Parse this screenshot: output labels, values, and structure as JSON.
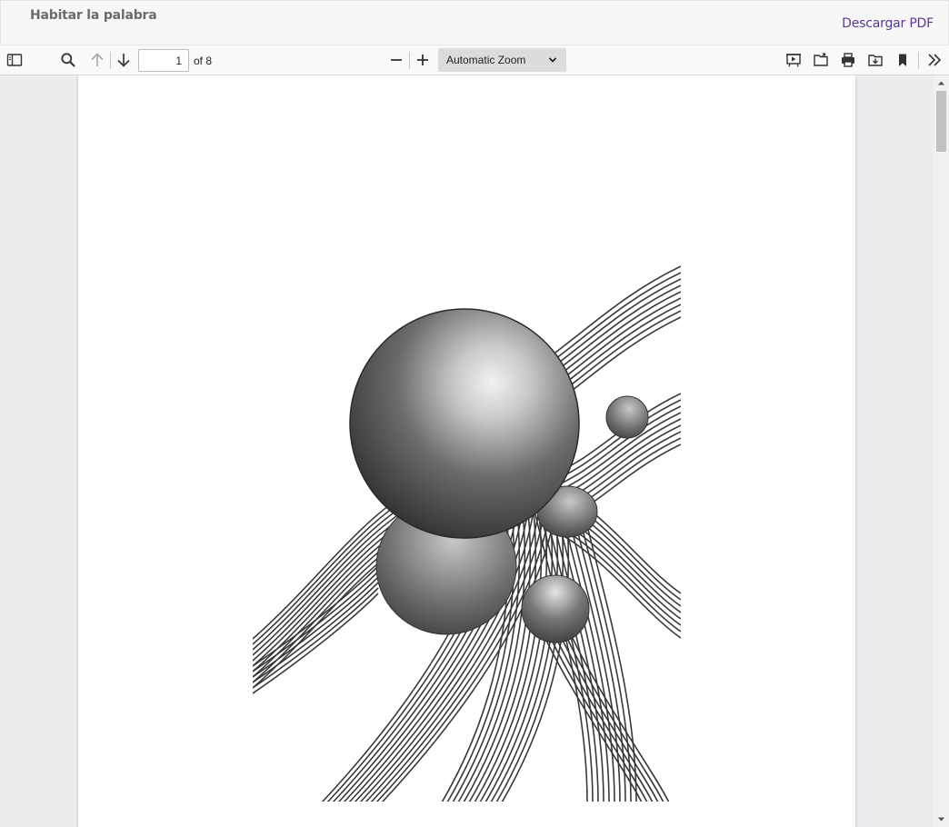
{
  "header": {
    "title": "Habitar la palabra",
    "download_label": "Descargar PDF",
    "accent_color": "#5b3a8c"
  },
  "toolbar": {
    "sidebar_toggle_icon": "sidebar-toggle-icon",
    "find_icon": "search-icon",
    "previous_icon": "arrow-up-icon",
    "next_icon": "arrow-down-icon",
    "page_number": "1",
    "page_count_label": "of 8",
    "zoom_out_icon": "minus-icon",
    "zoom_in_icon": "plus-icon",
    "zoom_value": "Automatic Zoom",
    "presentation_icon": "presentation-mode-icon",
    "open_file_icon": "open-file-icon",
    "print_icon": "print-icon",
    "download_icon": "download-icon",
    "bookmark_icon": "bookmark-icon",
    "tools_icon": "double-chevron-right-icon"
  },
  "document": {
    "current_page": 1,
    "total_pages": 8
  },
  "scrollbar": {
    "position_fraction": 0.0
  }
}
